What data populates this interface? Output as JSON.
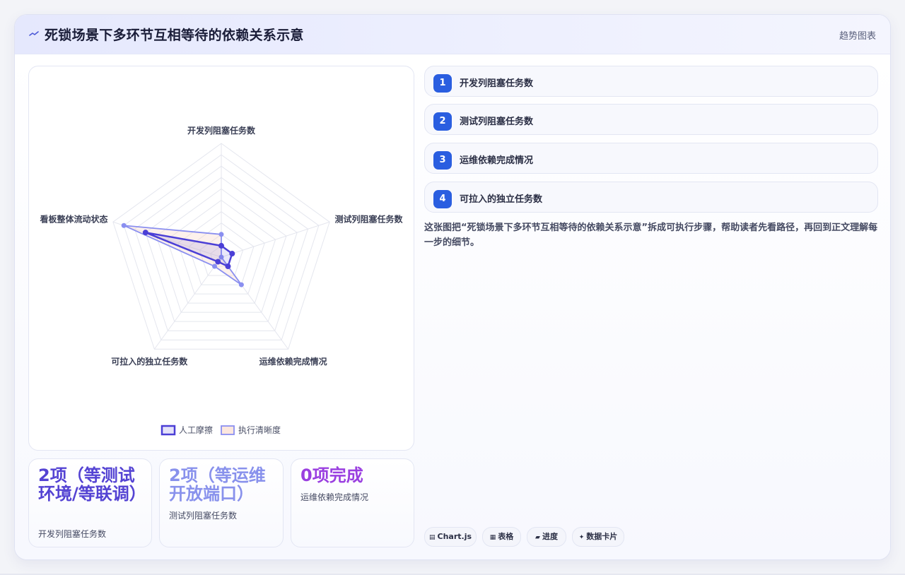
{
  "header": {
    "title": "死锁场景下多环节互相等待的依赖关系示意",
    "tag": "趋势图表",
    "icon": "trend-line-icon"
  },
  "chart_data": {
    "type": "radar",
    "title": "",
    "axes": [
      "开发列阻塞任务数",
      "测试列阻塞任务数",
      "运维依赖完成情况",
      "可拉入的独立任务数",
      "看板整体流动状态"
    ],
    "rmax": 10,
    "grid": true,
    "legend_position": "bottom",
    "series": [
      {
        "name": "人工摩擦",
        "values": [
          1,
          1,
          1,
          0.5,
          7
        ],
        "color": "#4b3fd6",
        "fill": "rgba(75,63,214,0.12)"
      },
      {
        "name": "执行清晰度",
        "values": [
          2,
          0,
          3,
          1,
          9
        ],
        "color": "#8a8ff0",
        "fill": "rgba(250,215,200,0.35)"
      }
    ]
  },
  "stats": [
    {
      "value": "2项（等测试环境/等联调）",
      "label": "开发列阻塞任务数",
      "color": "#5443d3"
    },
    {
      "value": "2项（等运维开放端口）",
      "label": "测试列阻塞任务数",
      "color": "#8891ec"
    },
    {
      "value": "0项完成",
      "label": "运维依赖完成情况",
      "color": "#9a3fe0"
    }
  ],
  "steps": [
    {
      "num": "1",
      "label": "开发列阻塞任务数"
    },
    {
      "num": "2",
      "label": "测试列阻塞任务数"
    },
    {
      "num": "3",
      "label": "运维依赖完成情况"
    },
    {
      "num": "4",
      "label": "可拉入的独立任务数"
    }
  ],
  "description": "这张图把“死锁场景下多环节互相等待的依赖关系示意”拆成可执行步骤，帮助读者先看路径，再回到正文理解每一步的细节。",
  "pills": [
    {
      "icon": "▤",
      "icon_name": "chart-icon",
      "label": "Chart.js"
    },
    {
      "icon": "▦",
      "icon_name": "table-icon",
      "label": "表格"
    },
    {
      "icon": "▰",
      "icon_name": "progress-icon",
      "label": "进度"
    },
    {
      "icon": "✦",
      "icon_name": "card-icon",
      "label": "数据卡片"
    }
  ]
}
